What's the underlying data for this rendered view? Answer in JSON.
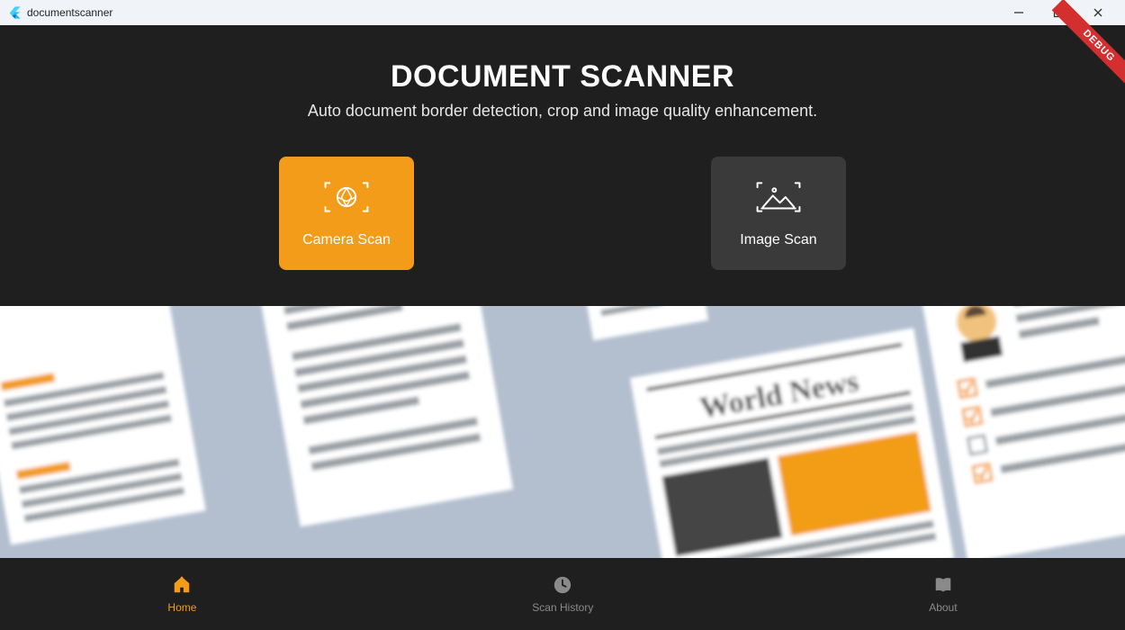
{
  "window": {
    "title": "documentscanner"
  },
  "debug_banner": "DEBUG",
  "hero": {
    "title": "DOCUMENT SCANNER",
    "subtitle": "Auto document border detection, crop and image quality enhancement."
  },
  "actions": {
    "camera_scan": "Camera Scan",
    "image_scan": "Image Scan"
  },
  "banner": {
    "newspaper_headline": "World News"
  },
  "nav": {
    "home": "Home",
    "history": "Scan History",
    "about": "About",
    "active": "home"
  },
  "colors": {
    "accent": "#F39C19",
    "dark": "#1f1f1f",
    "banner_bg": "#B3BFCF",
    "debug": "#D32F2F"
  }
}
